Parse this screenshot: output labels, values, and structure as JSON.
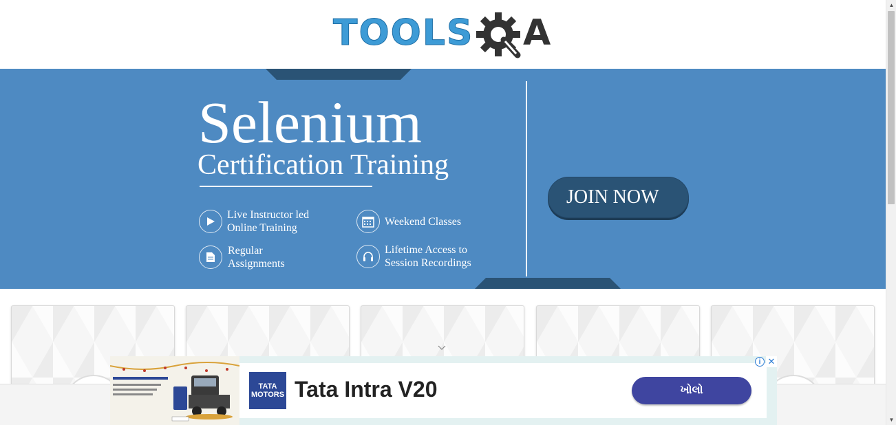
{
  "logo": {
    "text_tools": "TOOLS",
    "text_a": "A",
    "alt": "TOOLSQA"
  },
  "banner": {
    "title": "Selenium",
    "subtitle": "Certification Training",
    "features": [
      {
        "icon": "play-icon",
        "line1": "Live Instructor led",
        "line2": "Online Training"
      },
      {
        "icon": "calendar-icon",
        "line1": "Weekend Classes",
        "line2": ""
      },
      {
        "icon": "document-icon",
        "line1": "Regular",
        "line2": "Assignments"
      },
      {
        "icon": "headphones-icon",
        "line1": "Lifetime Access to",
        "line2": "Session Recordings"
      }
    ],
    "cta_label": "JOIN NOW",
    "colors": {
      "background": "#4e8ac2",
      "dark": "#2a5375"
    }
  },
  "cards": {
    "count": 5
  },
  "ad": {
    "brand_line1": "TATA",
    "brand_line2": "MOTORS",
    "title": "Tata Intra V20",
    "cta_label": "ખોલો",
    "info_icon": "info-icon",
    "close_icon": "close-icon",
    "image_caption": "INTRA V20 PICKUP"
  }
}
